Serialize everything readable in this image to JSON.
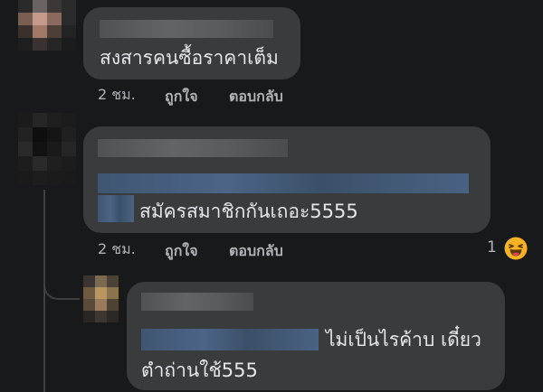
{
  "comments": [
    {
      "text": "สงสารคนซื้อราคาเต็ม",
      "time": "2 ชม.",
      "like_label": "ถูกใจ",
      "reply_label": "ตอบกลับ"
    },
    {
      "text": "สมัครสมาชิกกันเถอะ5555",
      "time": "2 ชม.",
      "like_label": "ถูกใจ",
      "reply_label": "ตอบกลับ",
      "reaction_count": "1",
      "reaction_icon": "haha-emoji-icon"
    },
    {
      "text_line1": "ไม่เป็นไรค้าบ เดี๋ยว",
      "text_line2": "ตำถ่านใช้555"
    }
  ],
  "colors": {
    "background": "#18191a",
    "bubble": "#3a3b3c",
    "text": "#e4e6eb",
    "meta": "#b0b3b8",
    "reaction_yellow": "#f7b125"
  }
}
